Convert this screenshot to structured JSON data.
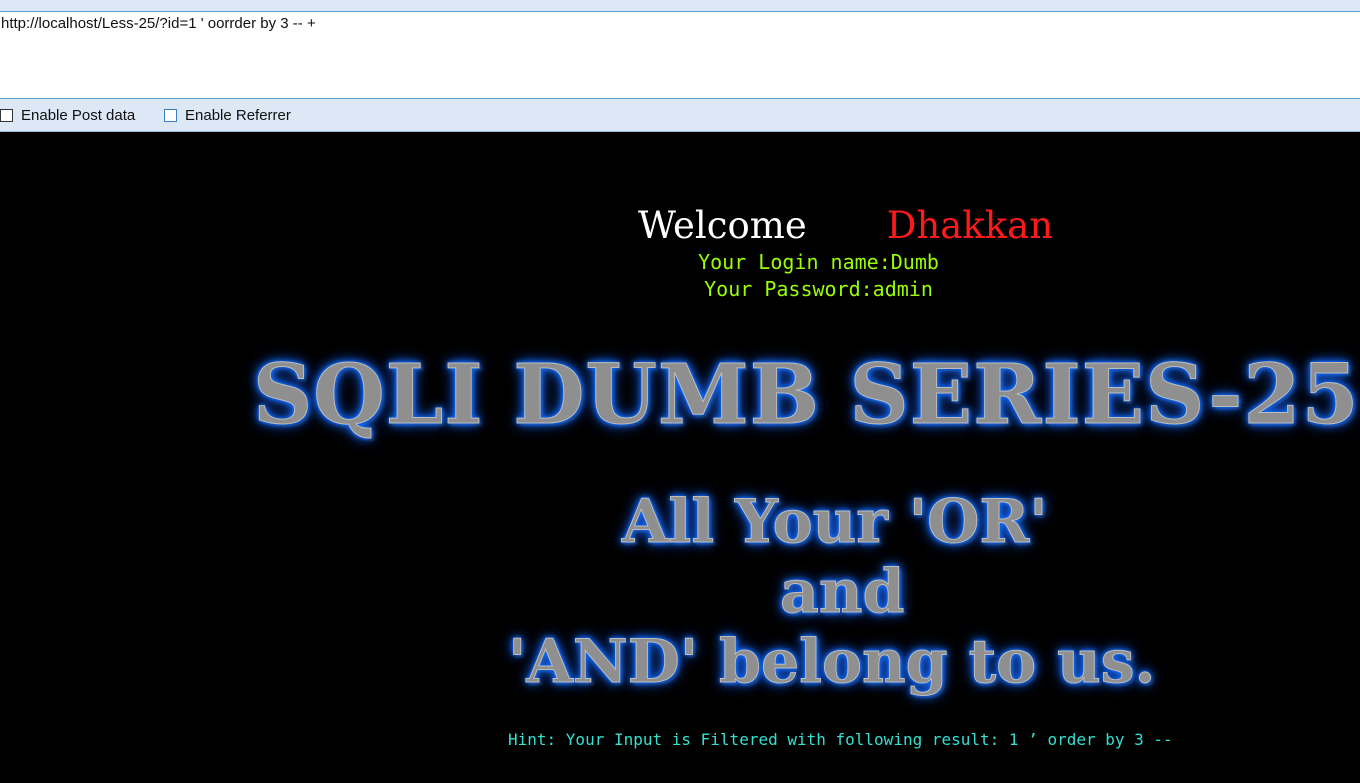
{
  "hackbar": {
    "url_value": "http://localhost/Less-25/?id=1 ' oorrder by 3 -- +",
    "options": {
      "post_label": "Enable Post data",
      "referrer_label": "Enable Referrer"
    }
  },
  "page": {
    "welcome": "Welcome",
    "name": "Dhakkan",
    "login_name": "Your Login name:Dumb",
    "password": "Your Password:admin",
    "banner_title": "SQLI DUMB SERIES-25",
    "banner_line1": "All Your 'OR'",
    "banner_line2": "and",
    "banner_line3": "'AND' belong to us.",
    "hint": "Hint: Your Input is Filtered with following result: 1 ’ order by 3 --"
  },
  "colors": {
    "background": "#000000",
    "welcome": "#ffffff",
    "name": "#ff1a1a",
    "credentials": "#99ff00",
    "hint": "#33e0d0",
    "banner_glow": "#0a6cff"
  }
}
